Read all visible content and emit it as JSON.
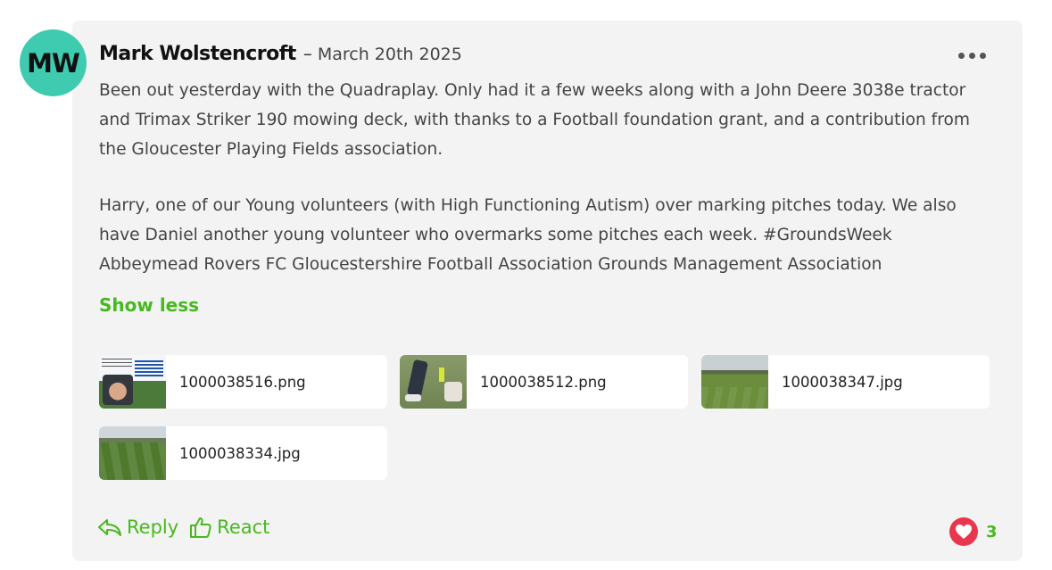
{
  "post": {
    "avatar_initials": "MW",
    "author": "Mark Wolstencroft",
    "separator": "–",
    "date": "March 20th 2025",
    "paragraph1": "Been out yesterday with the Quadraplay. Only had it a few weeks along with a John Deere 3038e tractor and Trimax Striker 190 mowing deck, with thanks to a Football foundation grant, and a contribution from the Gloucester Playing Fields association.",
    "paragraph2": "Harry, one of our Young volunteers (with High Functioning Autism) over marking pitches today. We also have Daniel another young volunteer who overmarks some pitches each week. #GroundsWeek Abbeymead Rovers FC Gloucestershire Football Association  Grounds Management Association",
    "show_less": "Show less"
  },
  "attachments": [
    {
      "name": "1000038516.png"
    },
    {
      "name": "1000038512.png"
    },
    {
      "name": "1000038347.jpg"
    },
    {
      "name": "1000038334.jpg"
    }
  ],
  "actions": {
    "reply": "Reply",
    "react": "React",
    "like_count": "3"
  },
  "colors": {
    "accent": "#47b81f",
    "avatar_bg": "#3fcbb0",
    "heart": "#e8364f",
    "card_bg": "#f3f3f3"
  },
  "icons": [
    "more-options-icon",
    "reply-icon",
    "thumbs-up-icon",
    "heart-icon"
  ]
}
